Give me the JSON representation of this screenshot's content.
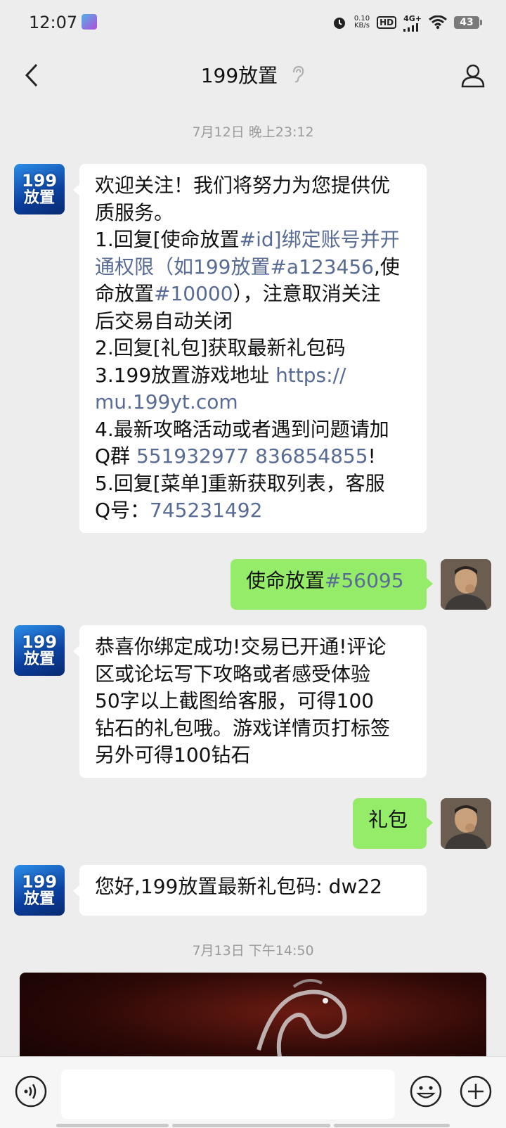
{
  "status_bar": {
    "time": "12:07",
    "net_speed_value": "0.10",
    "net_speed_unit": "KB/s",
    "hd": "HD",
    "network": "4G+",
    "battery": "43",
    "icons": [
      "alarm-icon",
      "signal-icon",
      "wifi-icon",
      "battery-icon"
    ]
  },
  "header": {
    "title": "199放置",
    "back_icon": "back-arrow-icon",
    "ear_icon": "ear-icon",
    "profile_icon": "profile-icon"
  },
  "chat": {
    "bot_avatar": {
      "num": "199",
      "text": "放置"
    },
    "timestamps": [
      "7月12日 晚上23:12",
      "7月13日 下午14:50"
    ],
    "msg1": {
      "l1": "欢迎关注！我们将努力为您提供优",
      "l2": "质服务。",
      "l3a": "1.回复[使命放置",
      "l3b": "#id]绑定账号并开",
      "l4a": "通权限（如199放置",
      "l4b": "#a123456",
      "l4c": ",使",
      "l5a": "命放置",
      "l5b": "#10000",
      "l5c": "），注意取消关注",
      "l6": "后交易自动关闭",
      "l7": "2.回复[礼包]获取最新礼包码",
      "l8a": "3.199放置游戏地址 ",
      "l8b": "https://",
      "l9": "mu.199yt.com",
      "l10": "4.最新攻略活动或者遇到问题请加",
      "l11a": "Q群 ",
      "l11b": "551932977 836854855",
      "l11c": "!",
      "l12": "5.回复[菜单]重新获取列表，客服",
      "l13a": "Q号：",
      "l13b": "745231492"
    },
    "msg2": {
      "a": "使命放置",
      "b": "#56095"
    },
    "msg3": {
      "l1": "恭喜你绑定成功!交易已开通!评论",
      "l2": "区或论坛写下攻略或者感受体验",
      "l3": "50字以上截图给客服，可得100",
      "l4": "钻石的礼包哦。游戏详情页打标签",
      "l5": "另外可得100钻石"
    },
    "msg4": "礼包",
    "msg5": "您好,199放置最新礼包码: dw22"
  },
  "input_bar": {
    "placeholder": "",
    "voice_icon": "voice-icon",
    "emoji_icon": "emoji-icon",
    "plus_icon": "plus-icon"
  },
  "colors": {
    "background": "#ededed",
    "outgoing_bubble": "#95ec69",
    "incoming_bubble": "#ffffff",
    "link": "#576b95",
    "timestamp": "#9a9a9a"
  }
}
